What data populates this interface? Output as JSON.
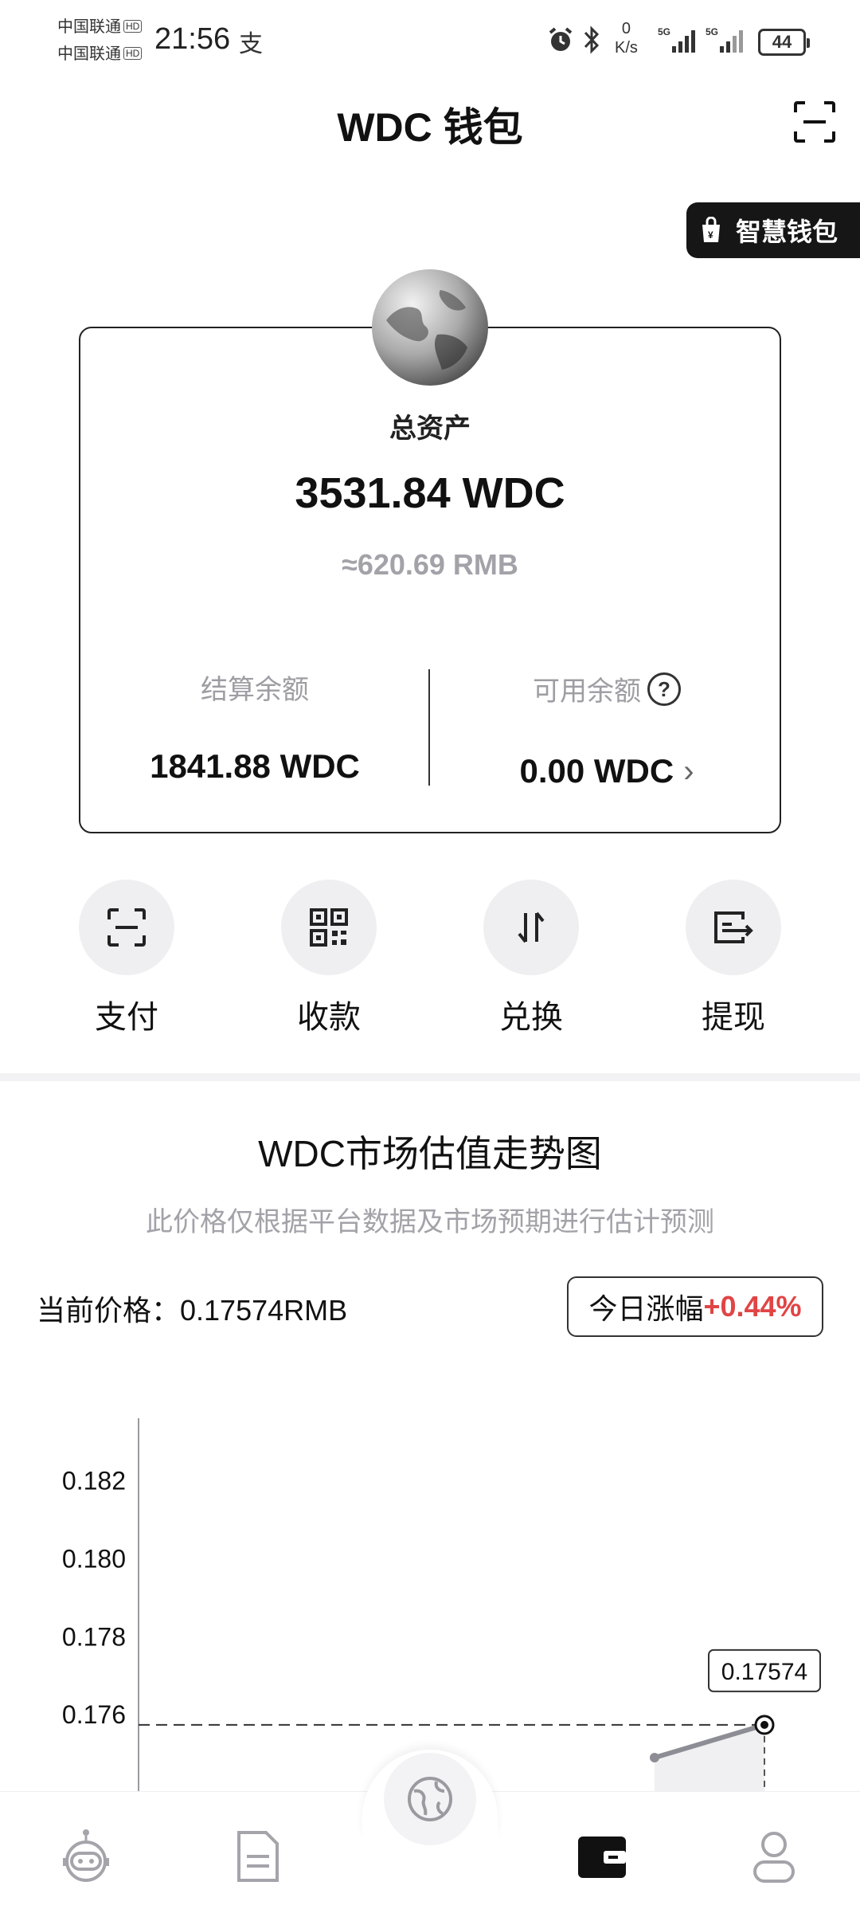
{
  "status_bar": {
    "carrier_1": "中国联通",
    "carrier_2": "中国联通",
    "hd_badge": "HD",
    "time": "21:56",
    "speed_value": "0",
    "speed_unit": "K/s",
    "signal_label": "5G",
    "battery": "44"
  },
  "header": {
    "title": "WDC 钱包",
    "scan_icon": "scan-icon"
  },
  "smart_wallet_label": "智慧钱包",
  "asset_card": {
    "total_label": "总资产",
    "total_amount": "3531.84 WDC",
    "rmb_approx": "≈620.69 RMB",
    "settlement_label": "结算余额",
    "settlement_value": "1841.88 WDC",
    "available_label": "可用余额",
    "available_value": "0.00 WDC"
  },
  "actions": [
    {
      "label": "支付",
      "icon": "scan-pay-icon"
    },
    {
      "label": "收款",
      "icon": "qr-code-icon"
    },
    {
      "label": "兑换",
      "icon": "exchange-icon"
    },
    {
      "label": "提现",
      "icon": "withdraw-icon"
    }
  ],
  "market": {
    "title": "WDC市场估值走势图",
    "subtitle": "此价格仅根据平台数据及市场预期进行估计预测",
    "current_price_label": "当前价格：0.17574RMB",
    "change_label": "今日涨幅",
    "change_value": "+0.44%",
    "colors": {
      "up": "#e04545",
      "line": "#8d8d95"
    }
  },
  "chart_data": {
    "type": "line",
    "title": "",
    "xlabel": "",
    "ylabel": "",
    "y_ticks": [
      "0.182",
      "0.180",
      "0.178",
      "0.176"
    ],
    "ylim": [
      0.174,
      0.1832
    ],
    "latest_value_label": "0.17574",
    "x": [
      0,
      1
    ],
    "values": [
      0.1749,
      0.17574
    ],
    "reference_line": 0.17574,
    "grid": false
  },
  "bottom_nav": [
    {
      "name": "robot",
      "icon": "robot-icon",
      "active": false
    },
    {
      "name": "document",
      "icon": "document-icon",
      "active": false
    },
    {
      "name": "globe",
      "icon": "globe-icon",
      "active": false
    },
    {
      "name": "wallet",
      "icon": "wallet-icon",
      "active": true
    },
    {
      "name": "profile",
      "icon": "user-icon",
      "active": false
    }
  ]
}
